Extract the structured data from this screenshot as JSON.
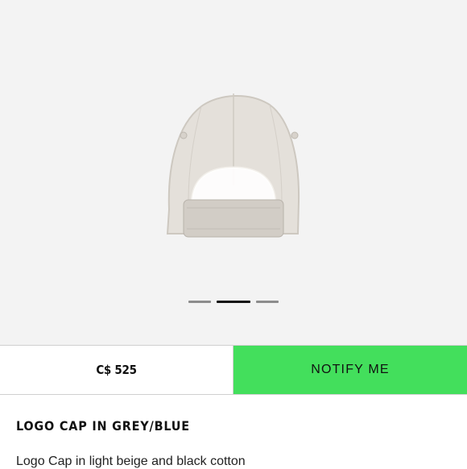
{
  "product": {
    "image_icon": "baseball-cap-back-view",
    "gallery": {
      "slide_count": 3,
      "active_index": 2
    },
    "price": "C$ 525",
    "notify_label": "NOTIFY ME",
    "title": "LOGO CAP IN GREY/BLUE",
    "description": "Logo Cap in light beige and black cotton"
  },
  "colors": {
    "accent": "#43df5c",
    "image_background": "#f3f3f3",
    "text": "#111111"
  }
}
